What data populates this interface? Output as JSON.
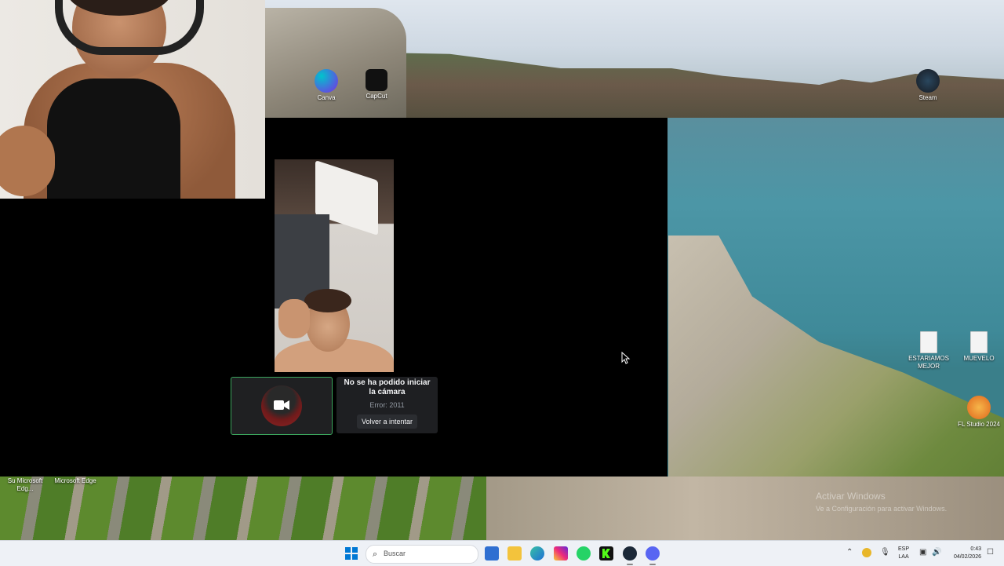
{
  "desktop": {
    "icons": [
      {
        "id": "canva",
        "label": "Canva",
        "color": "#7d2ae8"
      },
      {
        "id": "capcut",
        "label": "CapCut",
        "color": "#111111"
      },
      {
        "id": "steam",
        "label": "Steam",
        "color": "#1b2838"
      },
      {
        "id": "estariamos",
        "label": "ESTARIAMOS MEJOR"
      },
      {
        "id": "muevelo",
        "label": "MUEVELO"
      },
      {
        "id": "flstudio",
        "label": "FL Studio 2024",
        "color": "#f08a24"
      },
      {
        "id": "su",
        "label": "Su Microsoft Edg..."
      },
      {
        "id": "edge",
        "label": "Microsoft Edge"
      }
    ]
  },
  "call": {
    "error_title": "No se ha podido iniciar la cámara",
    "error_code": "Error: 2011",
    "retry_label": "Volver a intentar",
    "selected_border_color": "#3ba55d"
  },
  "watermark": {
    "title": "Activar Windows",
    "subtitle": "Ve a Configuración para activar Windows."
  },
  "taskbar": {
    "search_placeholder": "Buscar",
    "apps": [
      "windows-store-icon",
      "file-explorer-icon",
      "edge-icon",
      "instagram-icon",
      "whatsapp-icon",
      "kick-icon",
      "steam-icon",
      "discord-icon"
    ],
    "language_line1": "ESP",
    "language_line2": "LAA",
    "time": "0:43",
    "date": "04/02/2026"
  }
}
